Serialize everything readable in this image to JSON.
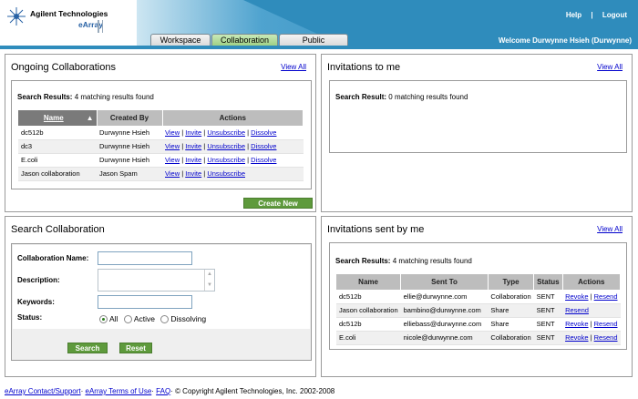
{
  "header": {
    "company": "Agilent Technologies",
    "product": "eArray",
    "links": [
      "Help",
      "|",
      "Logout"
    ],
    "welcome": "Welcome  Durwynne Hsieh (Durwynne)",
    "tabs": [
      "Workspace",
      "Collaboration",
      "Public"
    ]
  },
  "ongoing": {
    "title": "Ongoing Collaborations",
    "view_all": "View All",
    "search_label": "Search Results:",
    "search_count": "4 matching results found",
    "columns": [
      "Name",
      "Created By",
      "Actions"
    ],
    "rows": [
      {
        "name": "dc512b",
        "created_by": "Durwynne Hsieh",
        "actions": [
          "View",
          "Invite",
          "Unsubscribe",
          "Dissolve"
        ]
      },
      {
        "name": "dc3",
        "created_by": "Durwynne Hsieh",
        "actions": [
          "View",
          "Invite",
          "Unsubscribe",
          "Dissolve"
        ]
      },
      {
        "name": "E.coli",
        "created_by": "Durwynne Hsieh",
        "actions": [
          "View",
          "Invite",
          "Unsubscribe",
          "Dissolve"
        ]
      },
      {
        "name": "Jason collaboration",
        "created_by": "Jason Spam",
        "actions": [
          "View",
          "Invite",
          "Unsubscribe"
        ]
      }
    ],
    "create_new": "Create New"
  },
  "invitations_to_me": {
    "title": "Invitations to me",
    "view_all": "View All",
    "search_label": "Search Result:",
    "search_count": "0 matching results found"
  },
  "search_collab": {
    "title": "Search Collaboration",
    "name_label": "Collaboration Name:",
    "name_value": "",
    "description_label": "Description:",
    "description_value": "",
    "keywords_label": "Keywords:",
    "keywords_value": "",
    "status_label": "Status:",
    "status_options": [
      "All",
      "Active",
      "Dissolving"
    ],
    "status_selected": "All",
    "search_button": "Search",
    "reset_button": "Reset"
  },
  "invitations_sent": {
    "title": "Invitations sent by me",
    "view_all": "View All",
    "search_label": "Search Results:",
    "search_count": "4 matching results found",
    "columns": [
      "Name",
      "Sent To",
      "Type",
      "Status",
      "Actions"
    ],
    "rows": [
      {
        "name": "dc512b",
        "sent_to": "ellie@durwynne.com",
        "type": "Collaboration",
        "status": "SENT",
        "actions": [
          "Revoke",
          "Resend"
        ]
      },
      {
        "name": "Jason collaboration",
        "sent_to": "bambino@durwynne.com",
        "type": "Share",
        "status": "SENT",
        "actions": [
          "Resend"
        ]
      },
      {
        "name": "dc512b",
        "sent_to": "elliebass@durwynne.com",
        "type": "Share",
        "status": "SENT",
        "actions": [
          "Revoke",
          "Resend"
        ]
      },
      {
        "name": "E.coli",
        "sent_to": "nicole@durwynne.com",
        "type": "Collaboration",
        "status": "SENT",
        "actions": [
          "Revoke",
          "Resend"
        ]
      }
    ]
  },
  "footer": {
    "contact": "eArray Contact/Support",
    "terms": "eArray Terms of Use",
    "faq": "FAQ",
    "copyright": "© Copyright Agilent Technologies, Inc. 2002-2008"
  },
  "colors": {
    "header_blue": "#2f8cbc",
    "button_green": "#5e9a3c",
    "link_blue": "#0000cc",
    "table_header_gray": "#bdbdbd",
    "sorted_header_gray": "#7a7a7a"
  }
}
